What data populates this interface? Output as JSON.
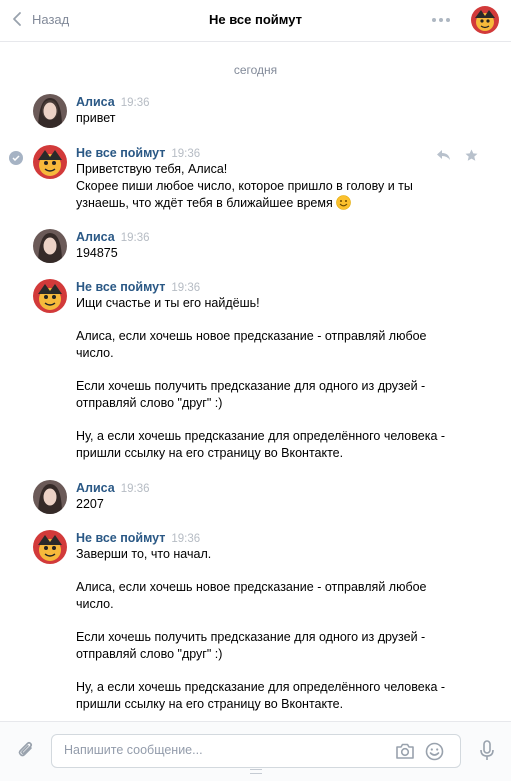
{
  "header": {
    "back_label": "Назад",
    "title": "Не все поймут"
  },
  "date_separator": "сегодня",
  "messages": [
    {
      "name": "Алиса",
      "time": "19:36",
      "lines": [
        "привет"
      ]
    },
    {
      "name": "Не все поймут",
      "time": "19:36",
      "lines": [
        "Приветствую тебя, Алиса!",
        "Скорее пиши любое число, которое пришло в голову и ты",
        "узнаешь, что ждёт тебя в ближайшее время"
      ]
    },
    {
      "name": "Алиса",
      "time": "19:36",
      "lines": [
        "194875"
      ]
    },
    {
      "name": "Не все поймут",
      "time": "19:36",
      "lines": [
        "Ищи счастье и ты его найдёшь!",
        "Алиса, если хочешь новое предсказание - отправляй любое",
        "число.",
        "Если хочешь получить предсказание для одного из друзей -",
        "отправляй слово \"друг\" :)",
        "Ну, а если хочешь предсказание для определённого человека -",
        "пришли ссылку на его страницу во Вконтакте."
      ]
    },
    {
      "name": "Алиса",
      "time": "19:36",
      "lines": [
        "2207"
      ]
    },
    {
      "name": "Не все поймут",
      "time": "19:36",
      "lines": [
        "Заверши то, что начал.",
        "Алиса, если хочешь новое предсказание - отправляй любое",
        "число.",
        "Если хочешь получить предсказание для одного из друзей -",
        "отправляй слово \"друг\" :)",
        "Ну, а если хочешь предсказание для определённого человека -",
        "пришли ссылку на его страницу во Вконтакте."
      ]
    }
  ],
  "composer": {
    "placeholder": "Напишите сообщение..."
  },
  "icons": {
    "back": "chevron-left-icon",
    "menu": "more-dots-icon",
    "reply": "reply-icon",
    "favorite": "star-icon",
    "read": "check-icon",
    "emoji": "smile-emoji-icon",
    "attach": "paperclip-icon",
    "camera": "camera-icon",
    "smile": "smile-icon",
    "mic": "microphone-icon"
  },
  "colors": {
    "link": "#2a5885",
    "muted": "#828a99",
    "border": "#e7e8ec"
  }
}
